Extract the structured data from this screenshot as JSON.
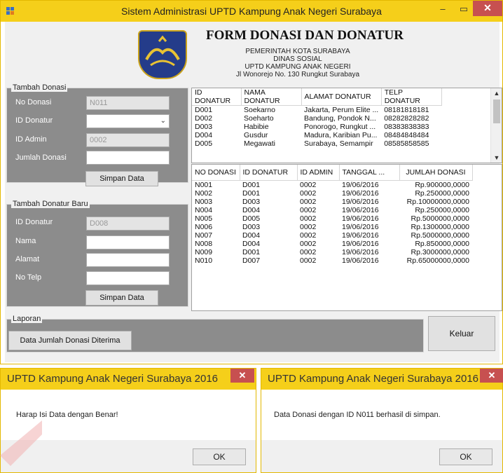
{
  "window": {
    "title": "Sistem Administrasi UPTD Kampung Anak Negeri Surabaya",
    "min": "–",
    "max": "▭",
    "close": "✕"
  },
  "header": {
    "title": "FORM DONASI DAN DONATUR",
    "lines": [
      "PEMERINTAH KOTA SURABAYA",
      "DINAS SOSIAL",
      "UPTD KAMPUNG ANAK NEGERI",
      "Jl Wonorejo No. 130 Rungkut Surabaya"
    ]
  },
  "tambah_donasi": {
    "legend": "Tambah Donasi",
    "no_donasi_label": "No Donasi",
    "no_donasi_value": "N011",
    "id_donatur_label": "ID Donatur",
    "id_donatur_value": "",
    "id_admin_label": "ID Admin",
    "id_admin_value": "0002",
    "jumlah_label": "Jumlah Donasi",
    "jumlah_value": "",
    "save_label": "Simpan Data"
  },
  "tambah_donatur": {
    "legend": "Tambah Donatur Baru",
    "id_donatur_label": "ID Donatur",
    "id_donatur_value": "D008",
    "nama_label": "Nama",
    "alamat_label": "Alamat",
    "telp_label": "No Telp",
    "save_label": "Simpan Data"
  },
  "donatur_grid": {
    "columns": [
      "ID DONATUR",
      "NAMA DONATUR",
      "ALAMAT DONATUR",
      "TELP DONATUR"
    ],
    "rows": [
      [
        "D001",
        "Soekarno",
        "Jakarta, Perum Elite ...",
        "08181818181"
      ],
      [
        "D002",
        "Soeharto",
        "Bandung, Pondok N...",
        "08282828282"
      ],
      [
        "D003",
        "Habibie",
        "Ponorogo, Rungkut ...",
        "08383838383"
      ],
      [
        "D004",
        "Gusdur",
        "Madura, Karibian Pu...",
        "08484848484"
      ],
      [
        "D005",
        "Megawati",
        "Surabaya, Semampir",
        "08585858585"
      ]
    ]
  },
  "donasi_grid": {
    "columns": [
      "NO DONASI",
      "ID DONATUR",
      "ID ADMIN",
      "TANGGAL ...",
      "JUMLAH DONASI"
    ],
    "rows": [
      [
        "N001",
        "D001",
        "0002",
        "19/06/2016",
        "Rp.900000,0000"
      ],
      [
        "N002",
        "D001",
        "0002",
        "19/06/2016",
        "Rp.250000,0000"
      ],
      [
        "N003",
        "D003",
        "0002",
        "19/06/2016",
        "Rp.10000000,0000"
      ],
      [
        "N004",
        "D004",
        "0002",
        "19/06/2016",
        "Rp.250000,0000"
      ],
      [
        "N005",
        "D005",
        "0002",
        "19/06/2016",
        "Rp.5000000,0000"
      ],
      [
        "N006",
        "D003",
        "0002",
        "19/06/2016",
        "Rp.1300000,0000"
      ],
      [
        "N007",
        "D004",
        "0002",
        "19/06/2016",
        "Rp.5000000,0000"
      ],
      [
        "N008",
        "D004",
        "0002",
        "19/06/2016",
        "Rp.850000,0000"
      ],
      [
        "N009",
        "D001",
        "0002",
        "19/06/2016",
        "Rp.3000000,0000"
      ],
      [
        "N010",
        "D007",
        "0002",
        "19/06/2016",
        "Rp.65000000,0000"
      ]
    ]
  },
  "laporan": {
    "legend": "Laporan",
    "button": "Data Jumlah Donasi Diterima"
  },
  "keluar_label": "Keluar",
  "dialog_error": {
    "title": "UPTD Kampung Anak Negeri Surabaya 2016",
    "message": "Harap Isi Data dengan Benar!",
    "ok": "OK",
    "close": "✕"
  },
  "dialog_success": {
    "title": "UPTD Kampung Anak Negeri Surabaya 2016",
    "message": "Data Donasi dengan ID N011 berhasil di simpan.",
    "ok": "OK",
    "close": "✕"
  },
  "colors": {
    "titlebar": "#f5cf1a",
    "close": "#c75050",
    "groupbox": "#8c8c8c"
  }
}
